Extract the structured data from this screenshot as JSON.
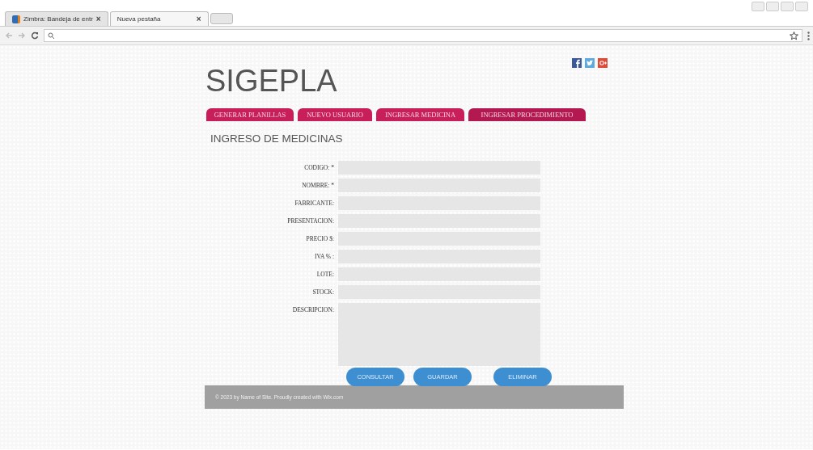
{
  "browser": {
    "tabs": [
      {
        "title": "Zimbra: Bandeja de entr",
        "close": "×",
        "selected": false
      },
      {
        "title": "Nueva pestaña",
        "close": "×",
        "selected": true
      }
    ]
  },
  "site": {
    "logo": "SIGEPLA",
    "nav": [
      {
        "label": "GENERAR PLANILLAS",
        "selected": false
      },
      {
        "label": "NUEVO USUARIO",
        "selected": false
      },
      {
        "label": "INGRESAR MEDICINA",
        "selected": false
      },
      {
        "label": "INGRESAR PROCEDIMIENTO",
        "selected": true
      }
    ],
    "heading": "INGRESO DE MEDICINAS",
    "fields": [
      {
        "label": "CODIGO: *",
        "kind": "input"
      },
      {
        "label": "NOMBRE: *",
        "kind": "input"
      },
      {
        "label": "FABRICANTE:",
        "kind": "input"
      },
      {
        "label": "PRESENTACION:",
        "kind": "input"
      },
      {
        "label": "PRECIO $:",
        "kind": "input"
      },
      {
        "label": "IVA % :",
        "kind": "input"
      },
      {
        "label": "LOTE:",
        "kind": "input"
      },
      {
        "label": "STOCK:",
        "kind": "input"
      },
      {
        "label": "DESCRIPCION:",
        "kind": "textarea"
      }
    ],
    "buttons": [
      "CONSULTAR",
      "GUARDAR",
      "ELIMINAR"
    ],
    "footer": "© 2023 by Name of Site. Proudly created with Wix.com"
  }
}
